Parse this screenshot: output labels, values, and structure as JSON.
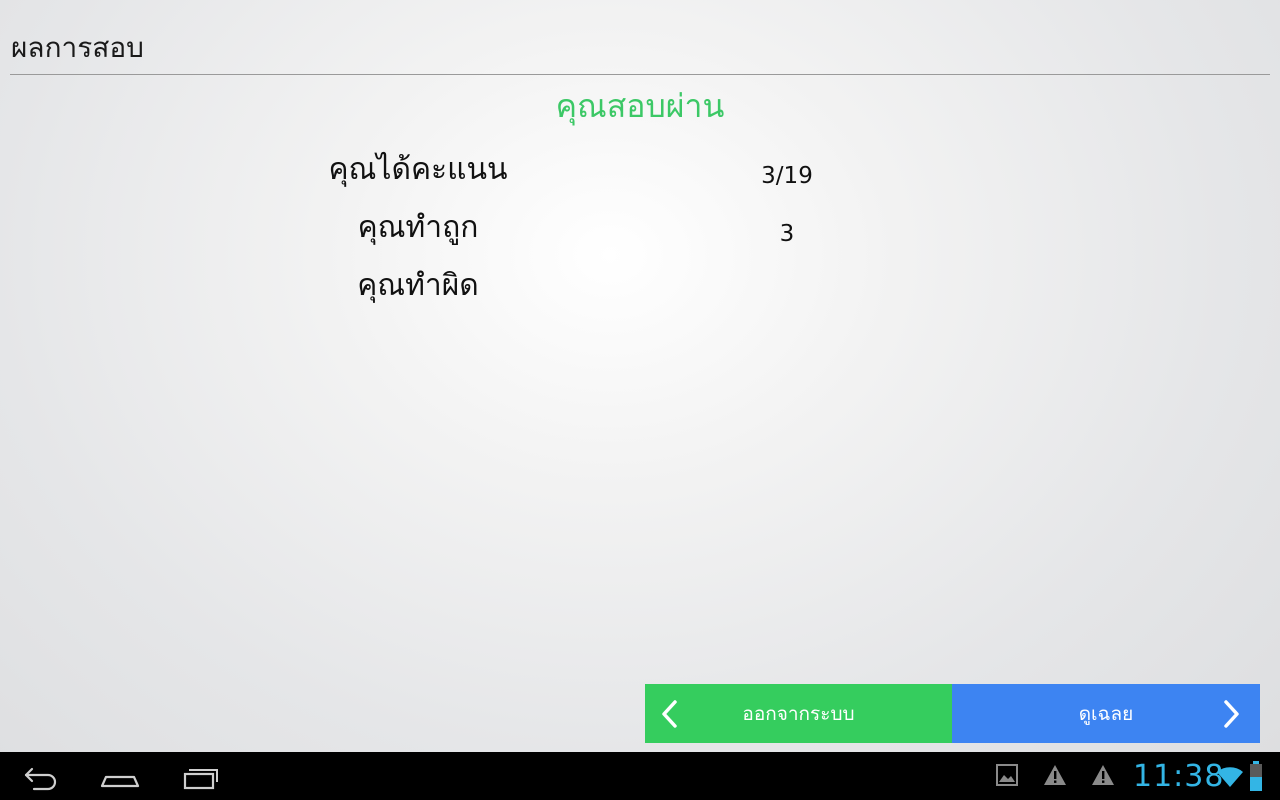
{
  "app": {
    "title": "ผลการสอบ"
  },
  "result": {
    "heading": "คุณสอบผ่าน",
    "heading_color": "#3cc866",
    "rows": [
      {
        "label": "คุณได้คะแนน",
        "value": "3/19"
      },
      {
        "label": "คุณทำถูก",
        "value": "3"
      },
      {
        "label": "คุณทำผิด",
        "value": ""
      }
    ]
  },
  "buttons": {
    "exit": {
      "label": "ออกจากระบบ",
      "icon": "chevron-left-icon",
      "color": "#35cd5e"
    },
    "answers": {
      "label": "ดูเฉลย",
      "icon": "chevron-right-icon",
      "color": "#3d84f2"
    }
  },
  "navbar": {
    "icons": [
      "back-icon",
      "home-icon",
      "recent-apps-icon"
    ],
    "status_icons": [
      "gallery-notification-icon",
      "warning-icon",
      "warning-icon",
      "wifi-icon",
      "battery-icon"
    ],
    "clock": "11:38",
    "clock_color": "#33b5e5"
  }
}
